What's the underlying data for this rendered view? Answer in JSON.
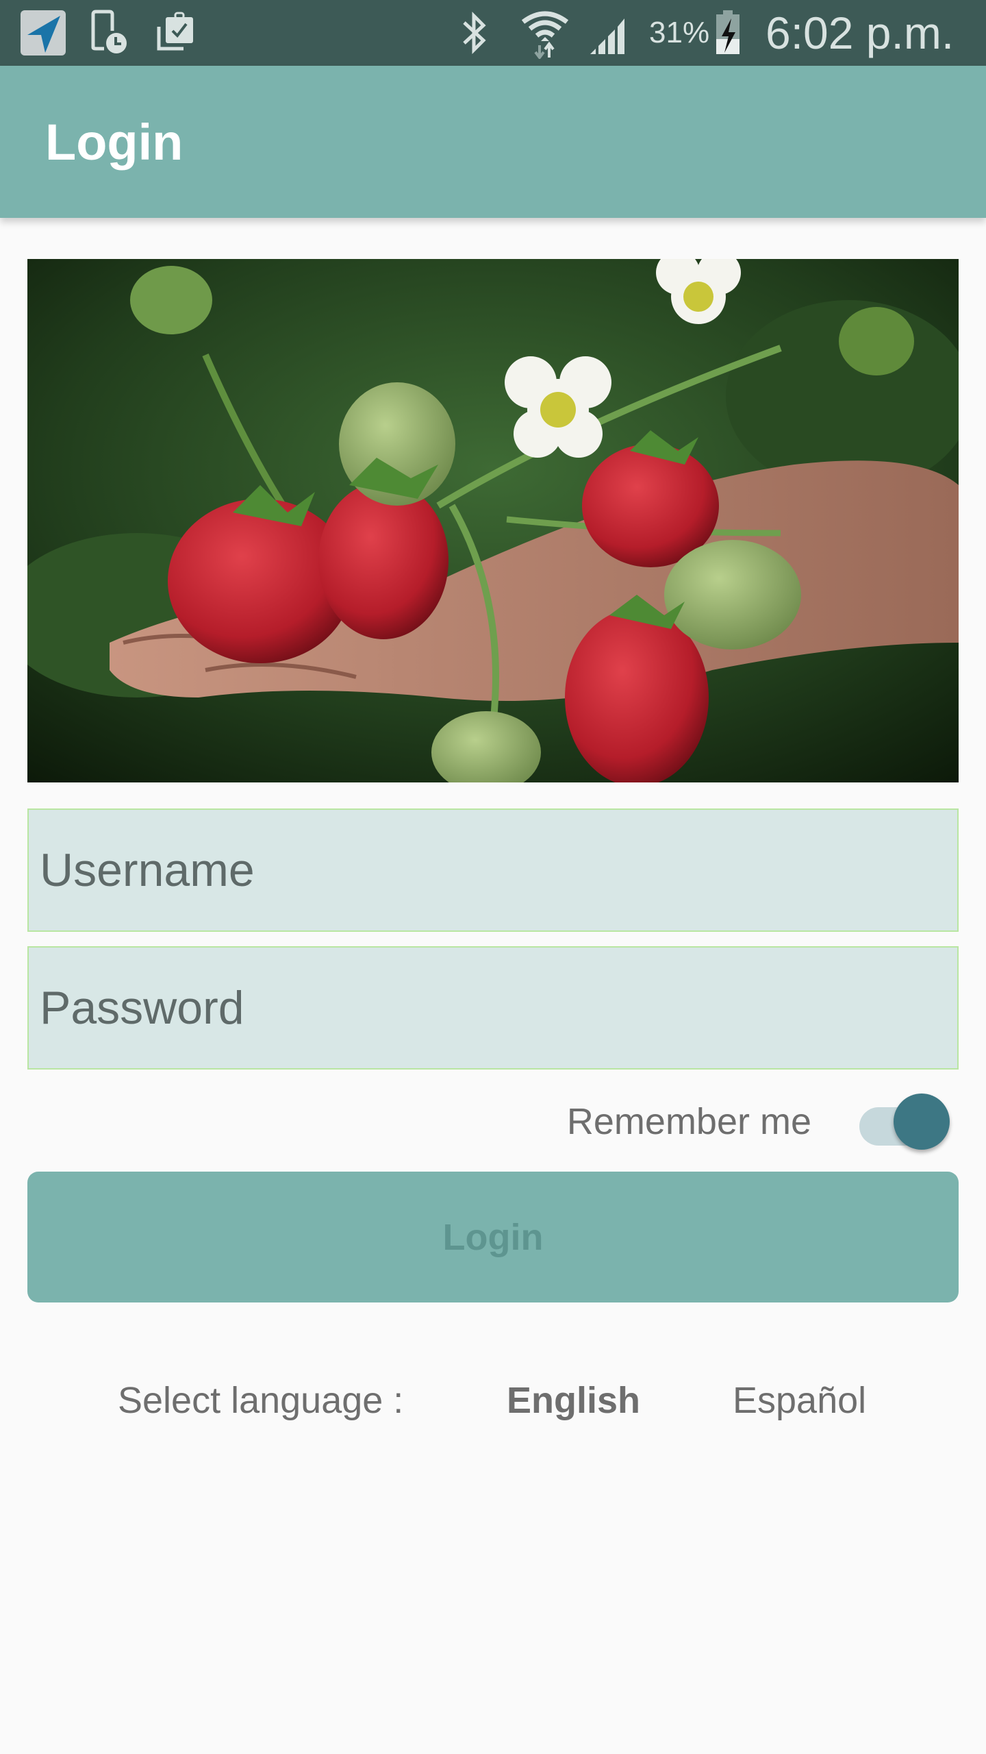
{
  "status_bar": {
    "icons_left": [
      "navigation-icon",
      "device-clock-icon",
      "clipboard-check-icon"
    ],
    "icons_right": [
      "bluetooth-icon",
      "wifi-icon",
      "signal-icon",
      "battery-charging-icon"
    ],
    "battery": "31%",
    "time": "6:02 p.m."
  },
  "app_bar": {
    "title": "Login"
  },
  "hero": {
    "description": "Hand holding strawberries with blossoms"
  },
  "form": {
    "username": {
      "placeholder": "Username",
      "value": ""
    },
    "password": {
      "placeholder": "Password",
      "value": ""
    },
    "remember_me": {
      "label": "Remember me",
      "checked": true
    },
    "login_button": "Login"
  },
  "language": {
    "label": "Select language :",
    "options": [
      {
        "label": "English",
        "selected": true
      },
      {
        "label": "Español",
        "selected": false
      }
    ]
  },
  "colors": {
    "status_bar": "#3d5a56",
    "primary": "#7bb3ad",
    "field_bg": "#d8e7e6",
    "field_border": "#b9e6a2",
    "toggle_thumb": "#3d7784",
    "toggle_track": "#c6d8dc",
    "background": "#fafafa"
  }
}
